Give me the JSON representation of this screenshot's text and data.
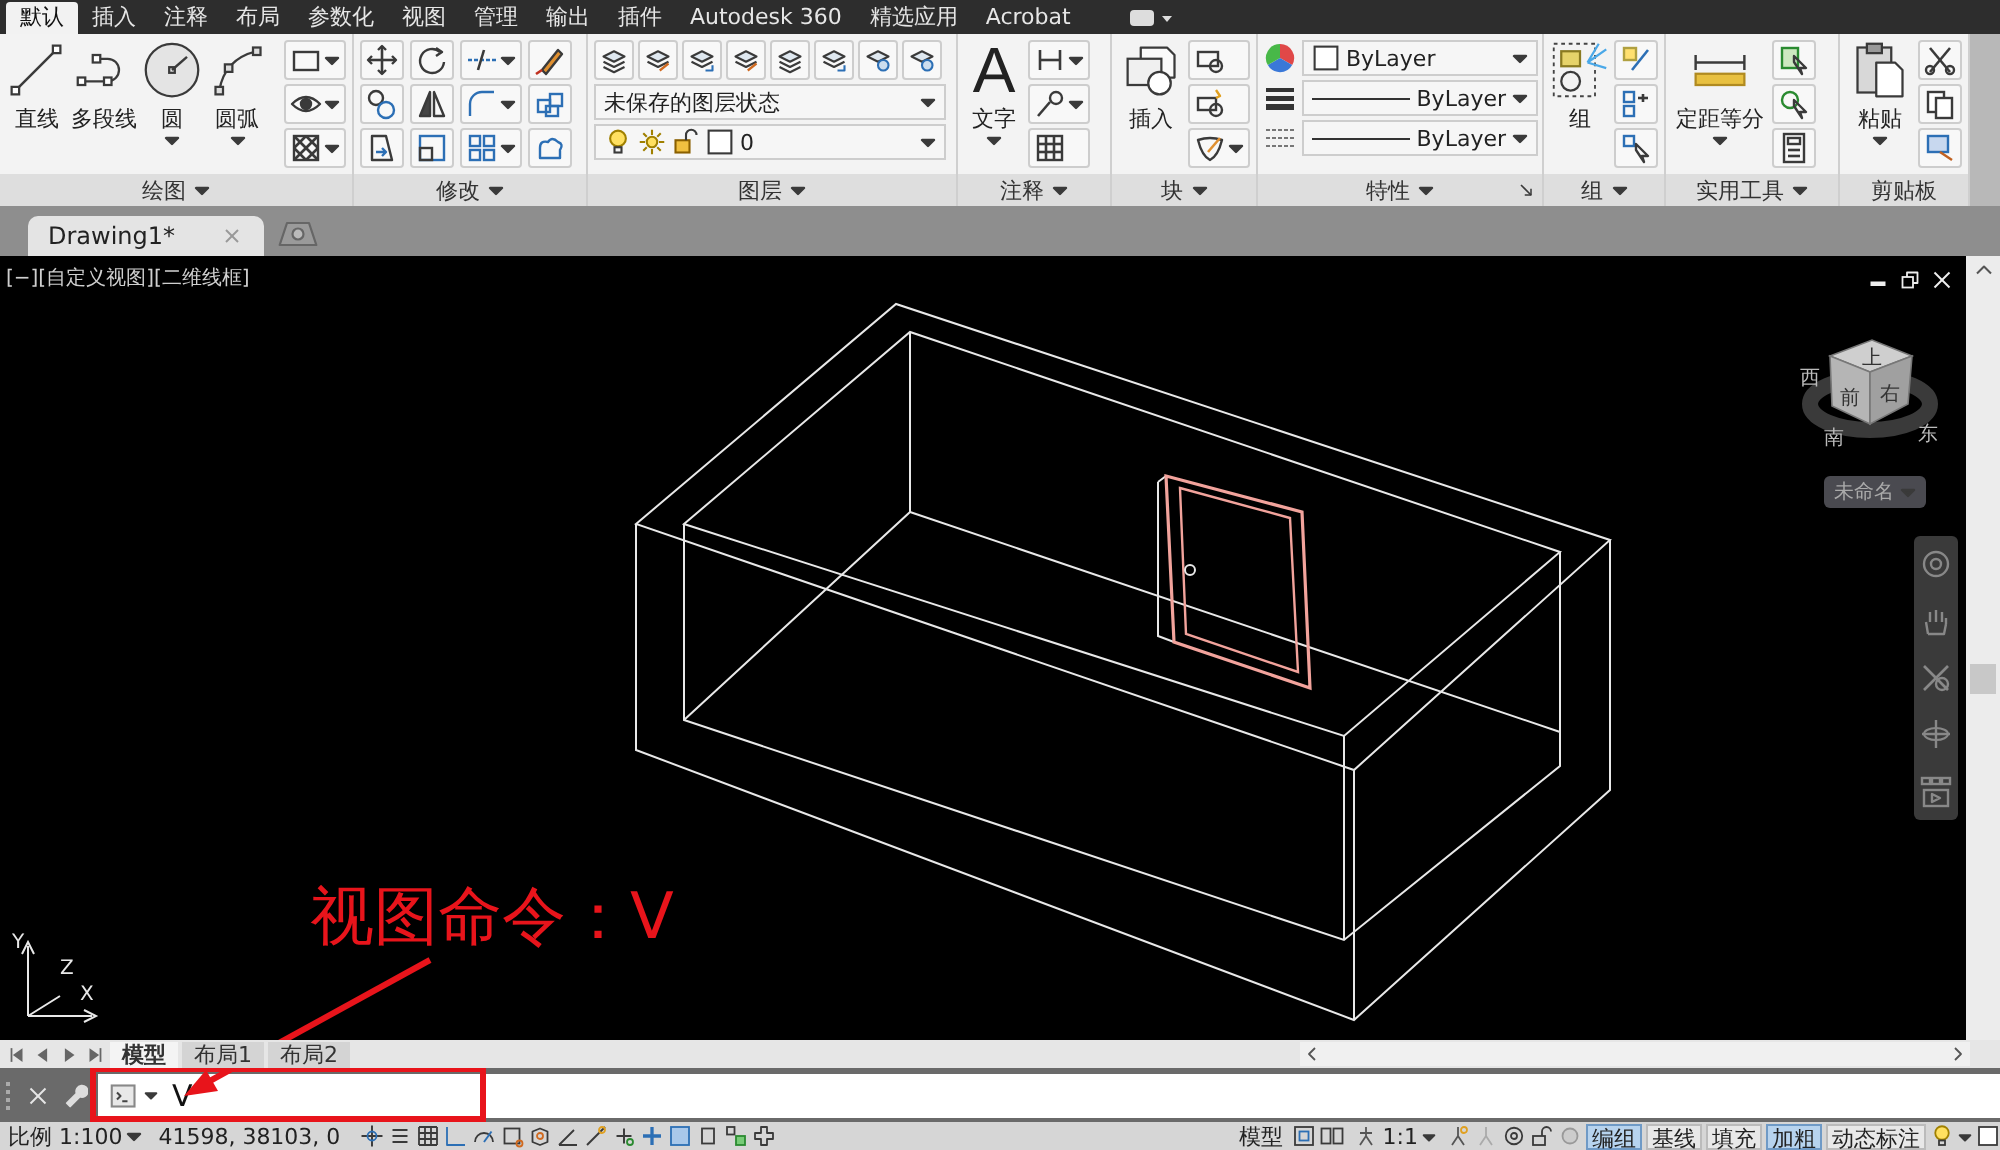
{
  "menu_tabs": [
    {
      "label": "默认",
      "selected": true
    },
    {
      "label": "插入",
      "selected": false
    },
    {
      "label": "注释",
      "selected": false
    },
    {
      "label": "布局",
      "selected": false
    },
    {
      "label": "参数化",
      "selected": false
    },
    {
      "label": "视图",
      "selected": false
    },
    {
      "label": "管理",
      "selected": false
    },
    {
      "label": "输出",
      "selected": false
    },
    {
      "label": "插件",
      "selected": false
    },
    {
      "label": "Autodesk 360",
      "selected": false
    },
    {
      "label": "精选应用",
      "selected": false
    },
    {
      "label": "Acrobat",
      "selected": false
    }
  ],
  "ribbon_panels": [
    {
      "title": "绘图",
      "menu": true,
      "large_tools": [
        {
          "label": "直线",
          "dropdown": false
        },
        {
          "label": "多段线",
          "dropdown": false
        },
        {
          "label": "圆",
          "dropdown": true
        },
        {
          "label": "圆弧",
          "dropdown": true
        }
      ]
    },
    {
      "title": "修改",
      "menu": true
    },
    {
      "title": "图层",
      "menu": true,
      "fields": [
        {
          "kind": "dropdown",
          "value": "未保存的图层状态"
        },
        {
          "kind": "layer",
          "value": "0"
        }
      ]
    },
    {
      "title": "注释",
      "menu": true,
      "large_tools": [
        {
          "label": "文字",
          "icon": "A",
          "dropdown": true
        }
      ]
    },
    {
      "title": "块",
      "menu": true,
      "large_tools": [
        {
          "label": "插入",
          "dropdown": false
        }
      ]
    },
    {
      "title": "特性",
      "menu": true,
      "launcher": true,
      "fields": [
        {
          "kind": "color",
          "value": "ByLayer"
        },
        {
          "kind": "lineweight",
          "value": "ByLayer"
        },
        {
          "kind": "linetype",
          "value": "ByLayer"
        }
      ]
    },
    {
      "title": "组",
      "menu": true,
      "large_tools": [
        {
          "label": "组",
          "dropdown": false
        }
      ]
    },
    {
      "title": "实用工具",
      "menu": true,
      "large_tools": [
        {
          "label": "定距等分",
          "dropdown": true
        }
      ]
    },
    {
      "title": "剪贴板",
      "menu": false,
      "large_tools": [
        {
          "label": "粘贴",
          "dropdown": true
        }
      ]
    }
  ],
  "document_tabs": [
    {
      "label": "Drawing1*",
      "selected": true
    }
  ],
  "viewport": {
    "label": "[−][自定义视图][二维线框]",
    "viewcube": {
      "top": "上",
      "front": "前",
      "right": "右",
      "compass": [
        "西",
        "南",
        "东"
      ],
      "ucs_menu": "未命名"
    },
    "ucs_axes": [
      "Y",
      "X",
      "Z"
    ]
  },
  "annotation": {
    "text": "视图命令：V"
  },
  "layout_tabs": [
    {
      "label": "模型",
      "selected": true
    },
    {
      "label": "布局1",
      "selected": false
    },
    {
      "label": "布局2",
      "selected": false
    }
  ],
  "command_line": {
    "value": "V"
  },
  "status_bar": {
    "scale": "比例 1:100",
    "coords": "41598, 38103, 0",
    "model": "模型",
    "anno_scale": "1:1",
    "toggles": [
      {
        "label": "编组",
        "on": true
      },
      {
        "label": "基线",
        "on": false
      },
      {
        "label": "填充",
        "on": false
      },
      {
        "label": "加粗",
        "on": true
      },
      {
        "label": "动态标注",
        "on": false
      }
    ]
  }
}
